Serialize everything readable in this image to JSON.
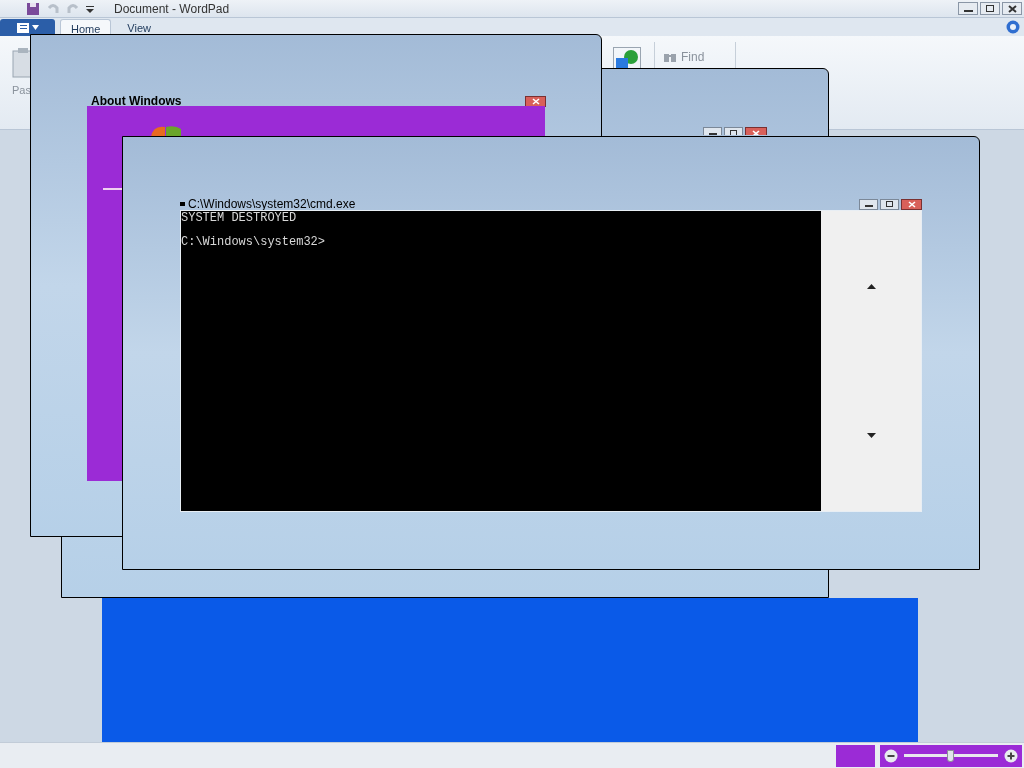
{
  "wordpad": {
    "title": "Document - WordPad",
    "tabs": [
      {
        "label": "Home",
        "selected": true
      },
      {
        "label": "View",
        "selected": false
      }
    ],
    "ribbon": {
      "paste_label": "Pas",
      "find_label": "Find"
    },
    "zoom": {
      "level": 0.5
    }
  },
  "about_window": {
    "title": "About Windows"
  },
  "cmd_window": {
    "title": "C:\\Windows\\system32\\cmd.exe",
    "lines": [
      "SYSTEM DESTROYED",
      "C:\\Windows\\system32>"
    ]
  }
}
